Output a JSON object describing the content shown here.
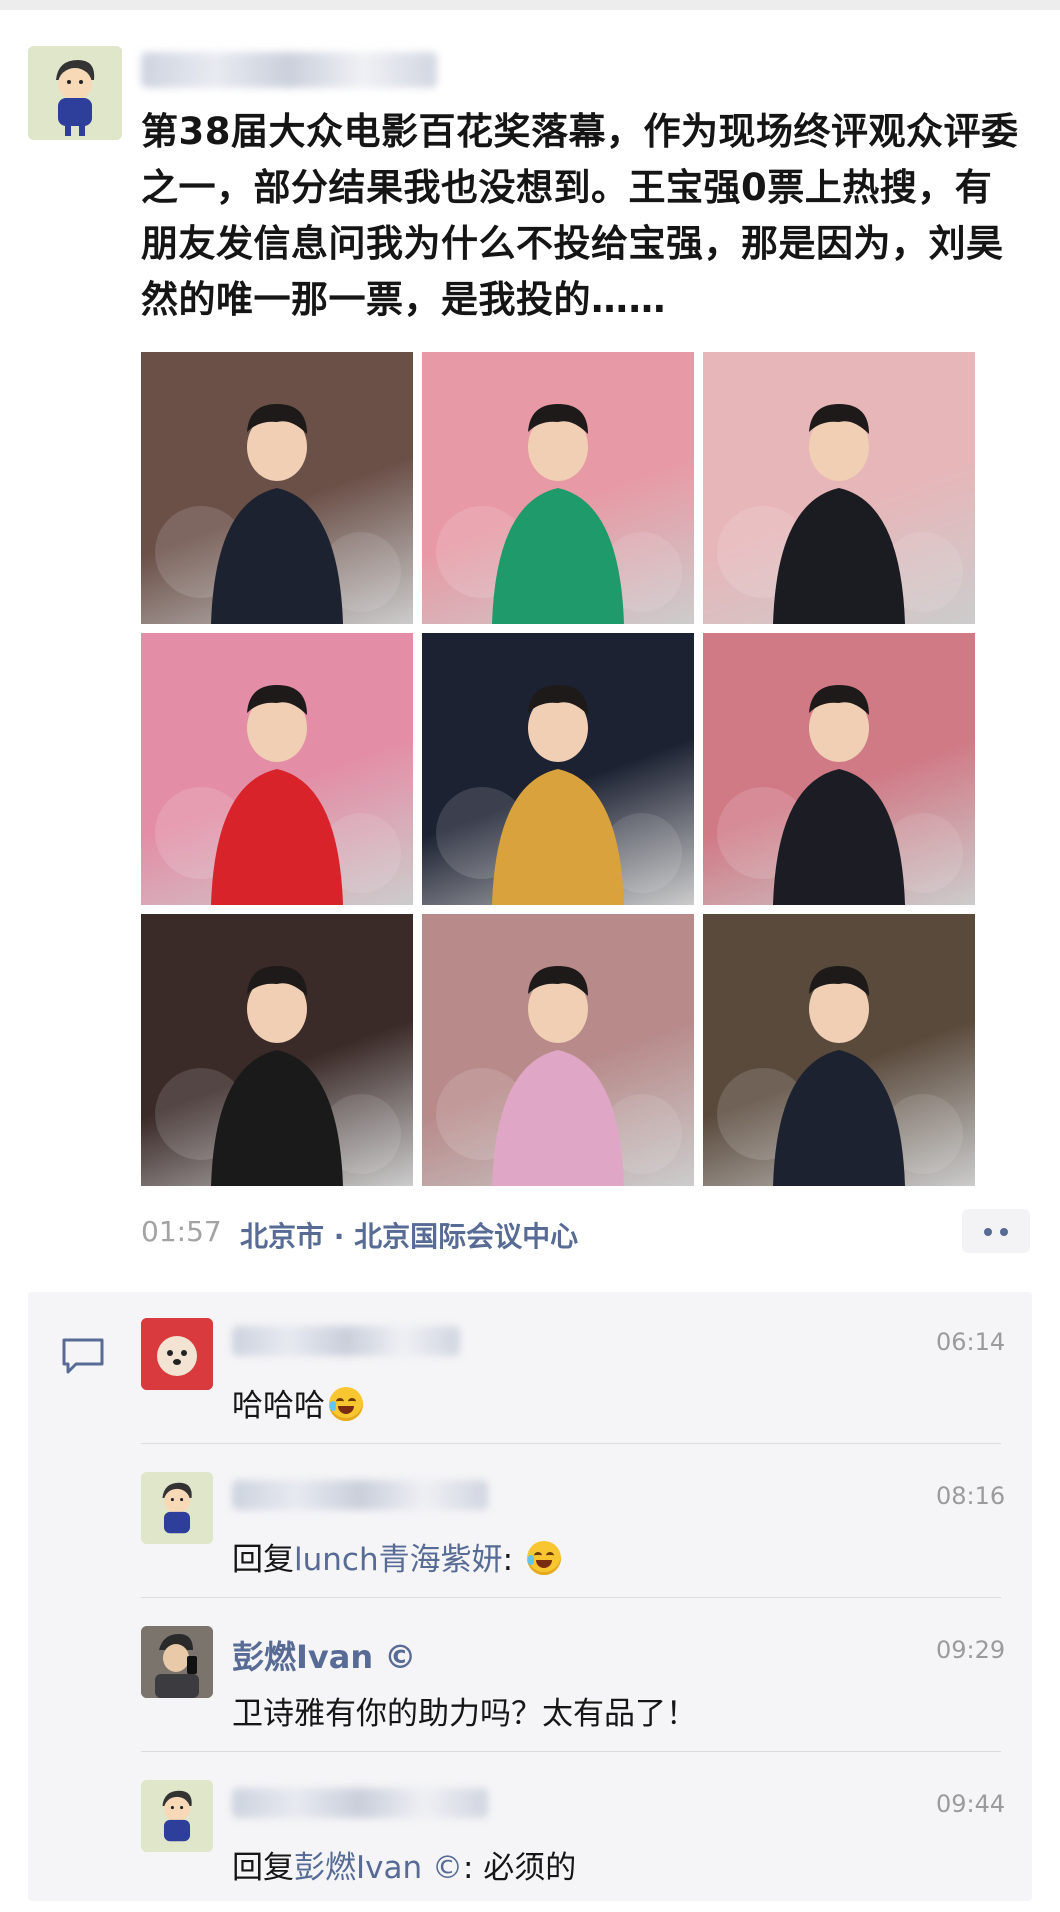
{
  "post": {
    "author_name": "",
    "text": "第38届大众电影百花奖落幕，作为现场终评观众评委之一，部分结果我也没想到。王宝强0票上热搜，有朋友发信息问我为什么不投给宝强，那是因为，刘昊然的唯一那一票，是我投的……",
    "time": "01:57",
    "location": "北京市 · 北京国际会议中心"
  },
  "photos": [
    {
      "name": "photo-man-dark-suit-seated",
      "bg": "#6b5048",
      "fg": "#1d2230"
    },
    {
      "name": "photo-woman-green-dress-trophy",
      "bg": "#e79aa5",
      "fg": "#1f9a6a"
    },
    {
      "name": "photo-man-tuxedo-trophy",
      "bg": "#e7b6b9",
      "fg": "#1b1b22"
    },
    {
      "name": "photo-woman-red-gown-trophy",
      "bg": "#e38ea6",
      "fg": "#d8232b"
    },
    {
      "name": "photo-golden-statue-stage",
      "bg": "#1d2233",
      "fg": "#d9a23c"
    },
    {
      "name": "photo-man-glasses-certificate",
      "bg": "#d07a86",
      "fg": "#1c1c24"
    },
    {
      "name": "photo-woman-black-blazer",
      "bg": "#3a2a28",
      "fg": "#1a1a1a"
    },
    {
      "name": "photo-woman-pink-sequin-dress",
      "bg": "#b88a8a",
      "fg": "#e0a6c6"
    },
    {
      "name": "photo-man-clapping-audience",
      "bg": "#5a4a3c",
      "fg": "#1c2230"
    }
  ],
  "comments": [
    {
      "author": "",
      "time": "06:14",
      "text": "哈哈哈",
      "emoji": "laughing-tears-emoji"
    },
    {
      "author": "",
      "time": "08:16",
      "reply_prefix": "回复",
      "reply_to": "lunch青海紫妍",
      "text_after": ":",
      "emoji": "rolling-laugh-emoji"
    },
    {
      "author": "彭燃Ivan ©",
      "time": "09:29",
      "text": "卫诗雅有你的助力吗？太有品了！"
    },
    {
      "author": "",
      "time": "09:44",
      "reply_prefix": "回复",
      "reply_to": "彭燃Ivan ©",
      "text_after": ": 必须的"
    }
  ],
  "colors": {
    "link": "#576b95",
    "time": "#a3a3a3",
    "comment_bg": "#f5f5f7"
  }
}
